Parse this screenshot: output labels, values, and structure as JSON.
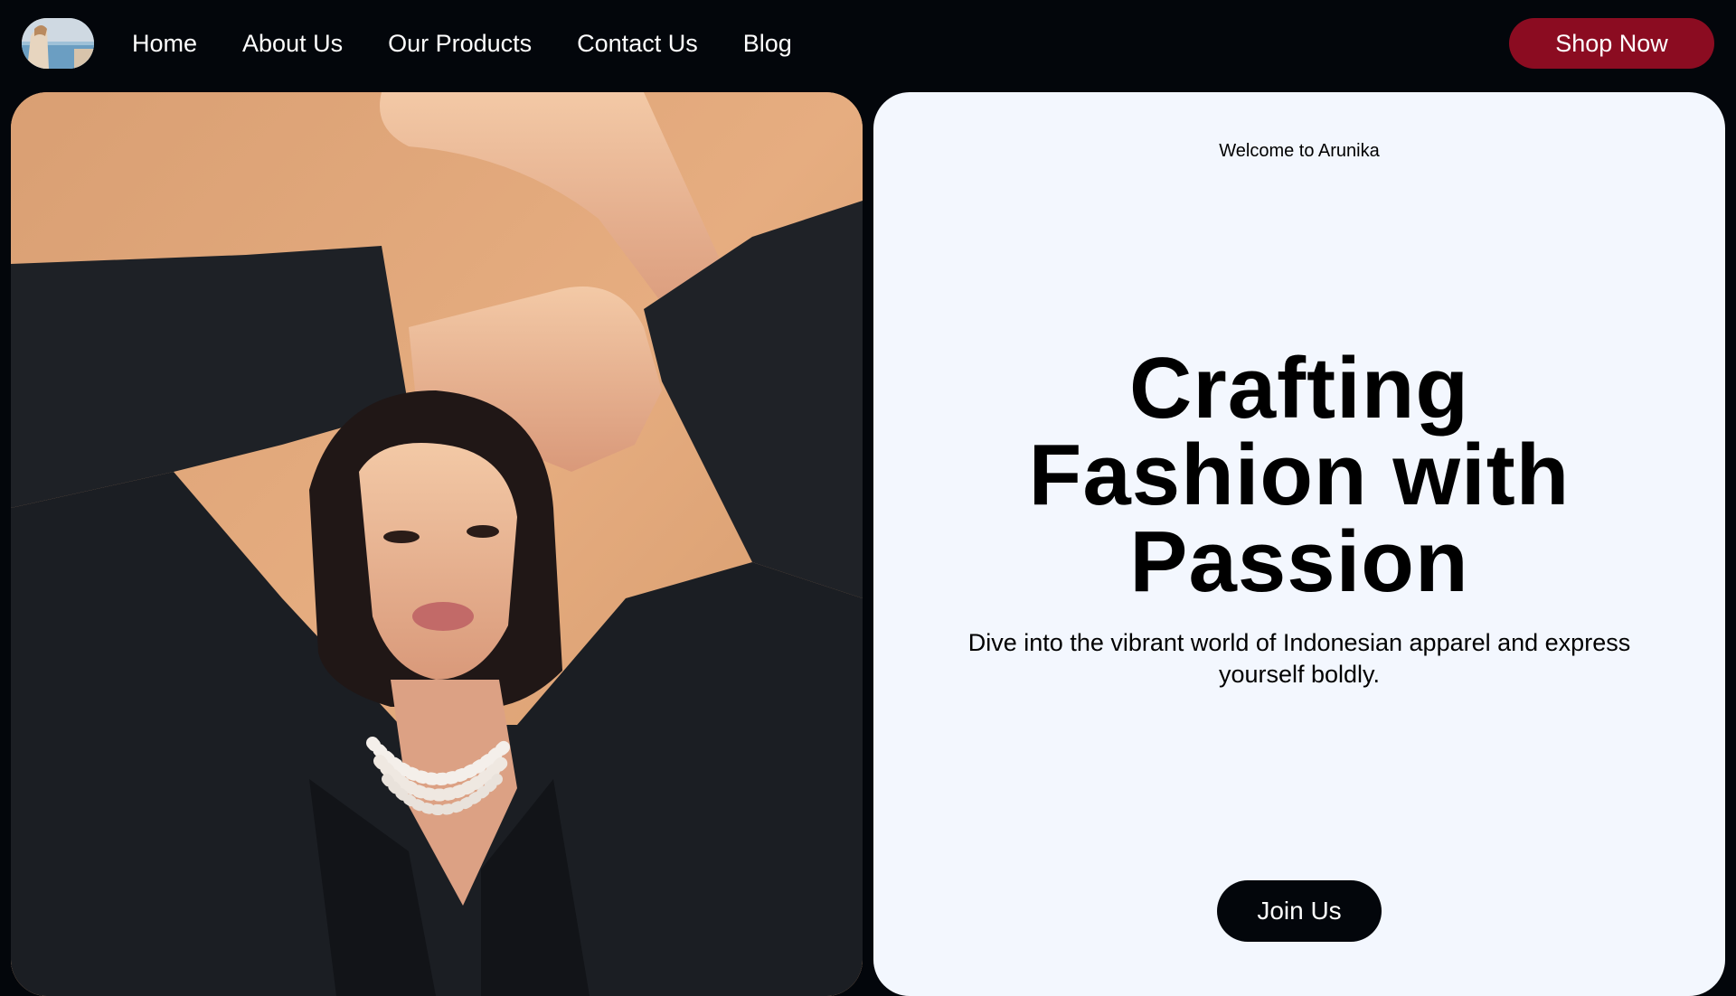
{
  "nav": {
    "logo_alt": "Arunika logo",
    "links": [
      {
        "label": "Home"
      },
      {
        "label": "About Us"
      },
      {
        "label": "Our Products"
      },
      {
        "label": "Contact Us"
      },
      {
        "label": "Blog"
      }
    ],
    "cta_label": "Shop Now"
  },
  "hero": {
    "welcome": "Welcome to Arunika",
    "headline": "Crafting Fashion with Passion",
    "subtext": "Dive into the vibrant world of Indonesian apparel and express yourself boldly.",
    "cta_label": "Join Us"
  },
  "colors": {
    "background": "#03060b",
    "accent": "#8b0c21",
    "panel": "#f3f7fe",
    "photo_backdrop": "#e2a979"
  }
}
